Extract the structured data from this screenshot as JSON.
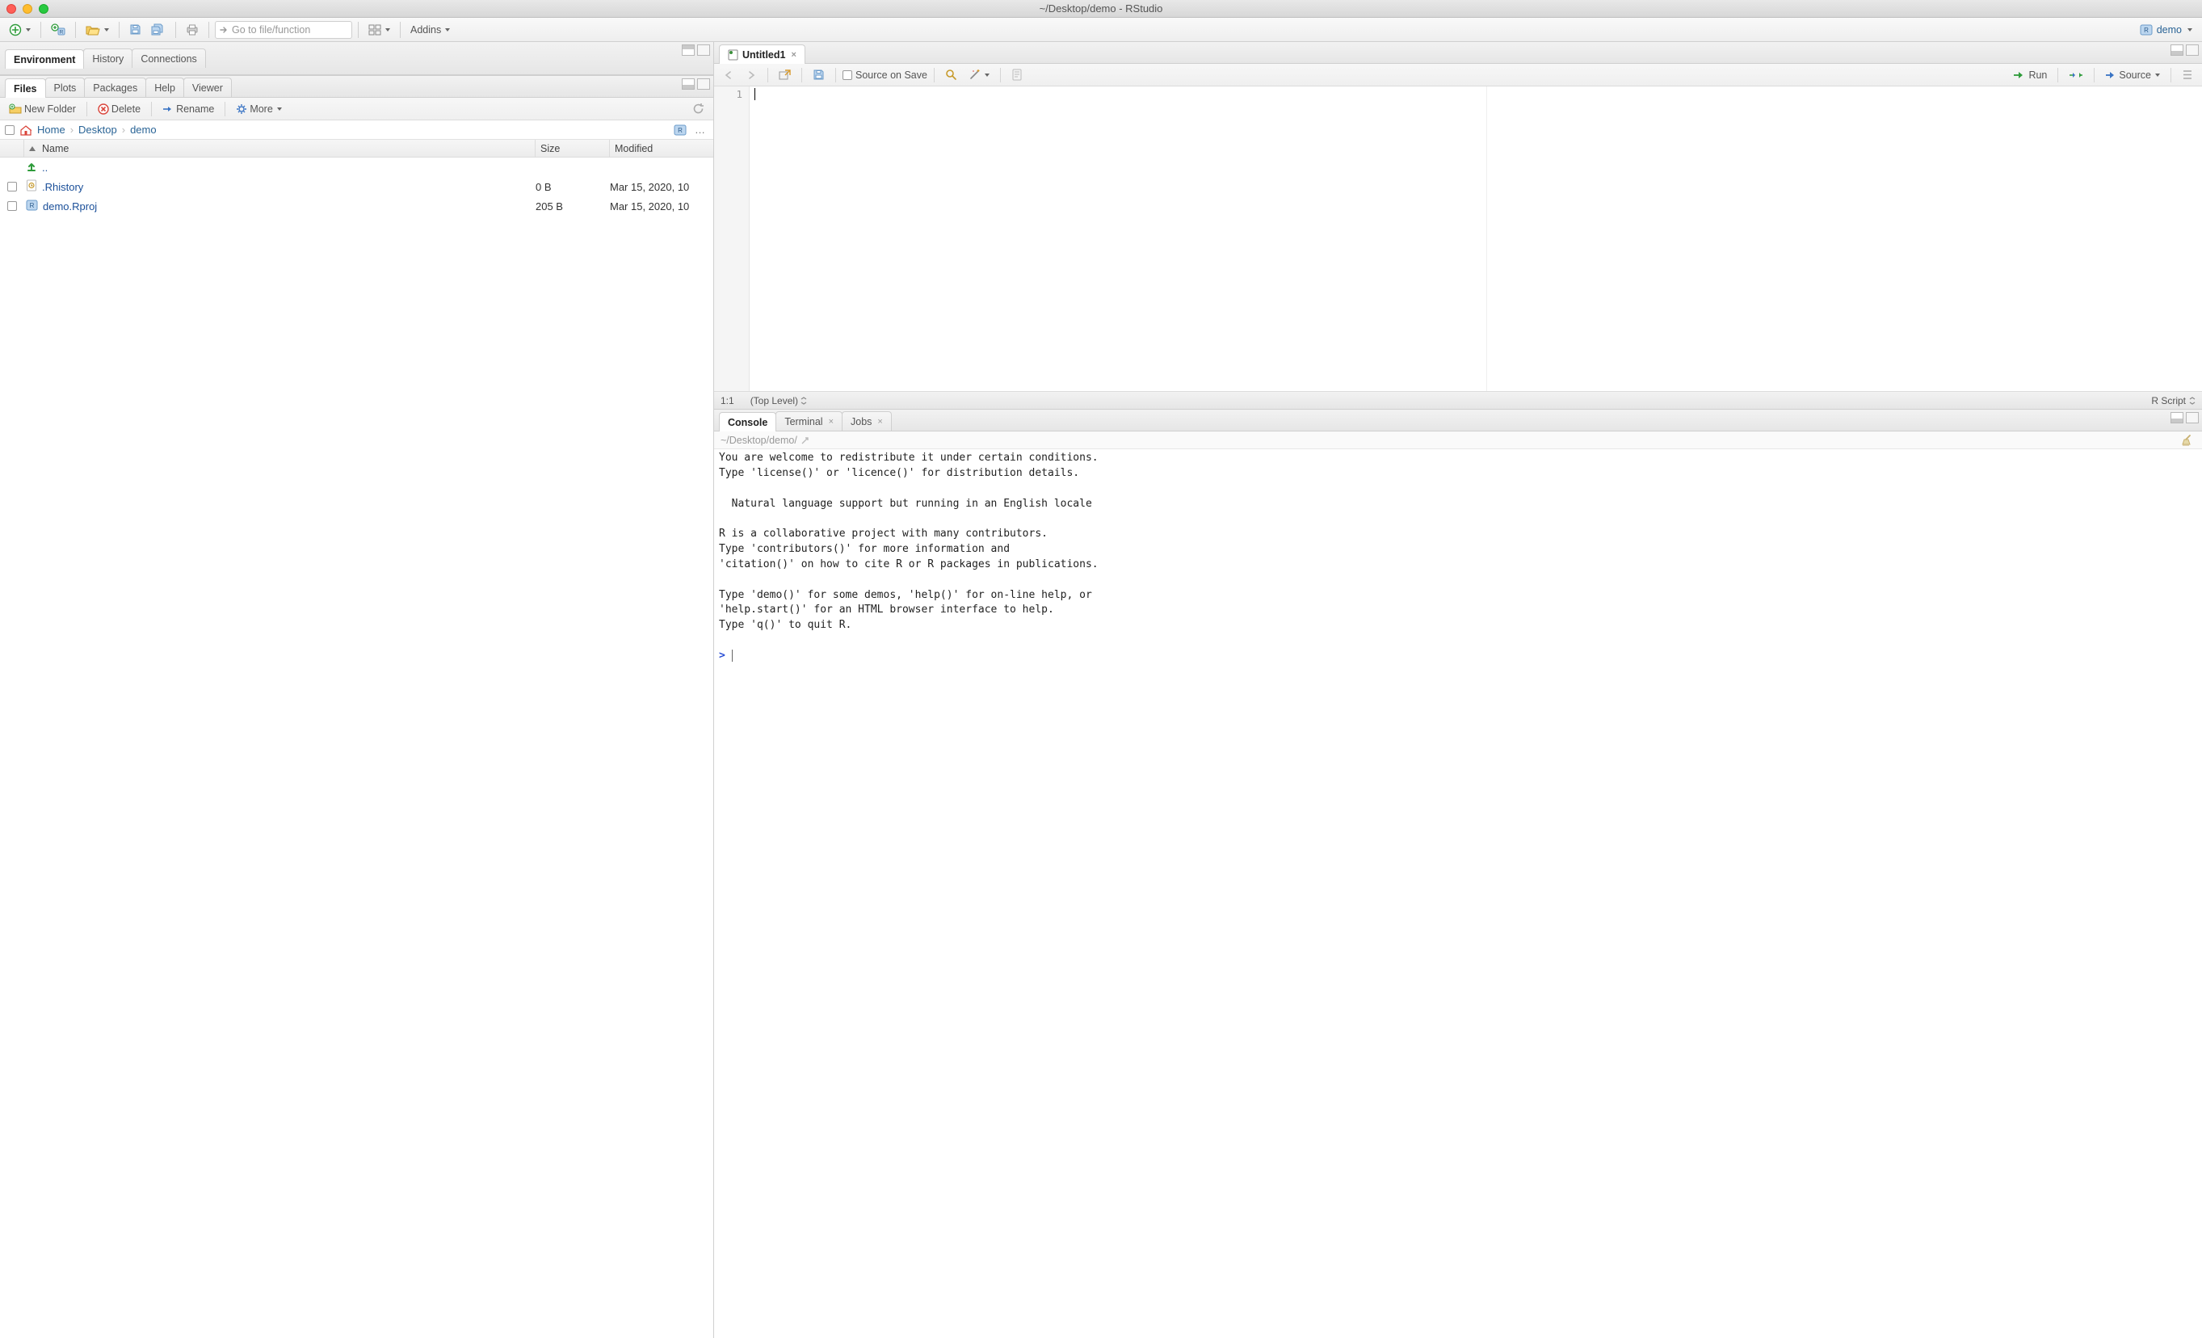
{
  "window": {
    "title": "~/Desktop/demo - RStudio"
  },
  "mainToolbar": {
    "goto_placeholder": "Go to file/function",
    "addins_label": "Addins",
    "project_label": "demo"
  },
  "source": {
    "tab_label": "Untitled1",
    "source_on_save_label": "Source on Save",
    "run_label": "Run",
    "source_btn_label": "Source",
    "line_number": "1",
    "status_pos": "1:1",
    "status_scope": "(Top Level)",
    "status_lang": "R Script"
  },
  "consolePane": {
    "tabs": {
      "console": "Console",
      "terminal": "Terminal",
      "jobs": "Jobs"
    },
    "path": "~/Desktop/demo/",
    "lines": [
      "You are welcome to redistribute it under certain conditions.",
      "Type 'license()' or 'licence()' for distribution details.",
      "",
      "  Natural language support but running in an English locale",
      "",
      "R is a collaborative project with many contributors.",
      "Type 'contributors()' for more information and",
      "'citation()' on how to cite R or R packages in publications.",
      "",
      "Type 'demo()' for some demos, 'help()' for on-line help, or",
      "'help.start()' for an HTML browser interface to help.",
      "Type 'q()' to quit R.",
      ""
    ],
    "prompt": ">"
  },
  "envPane": {
    "tabs": {
      "env": "Environment",
      "hist": "History",
      "conn": "Connections"
    }
  },
  "filesPane": {
    "tabs": {
      "files": "Files",
      "plots": "Plots",
      "packages": "Packages",
      "help": "Help",
      "viewer": "Viewer"
    },
    "toolbar": {
      "new_folder": "New Folder",
      "delete": "Delete",
      "rename": "Rename",
      "more": "More"
    },
    "breadcrumb": {
      "home": "Home",
      "c1": "Desktop",
      "c2": "demo"
    },
    "headers": {
      "name": "Name",
      "size": "Size",
      "modified": "Modified"
    },
    "rows": [
      {
        "icon": "up",
        "name": "..",
        "size": "",
        "modified": ""
      },
      {
        "icon": "hist",
        "name": ".Rhistory",
        "size": "0 B",
        "modified": "Mar 15, 2020, 10"
      },
      {
        "icon": "rproj",
        "name": "demo.Rproj",
        "size": "205 B",
        "modified": "Mar 15, 2020, 10"
      }
    ],
    "ellipsis": "…"
  }
}
